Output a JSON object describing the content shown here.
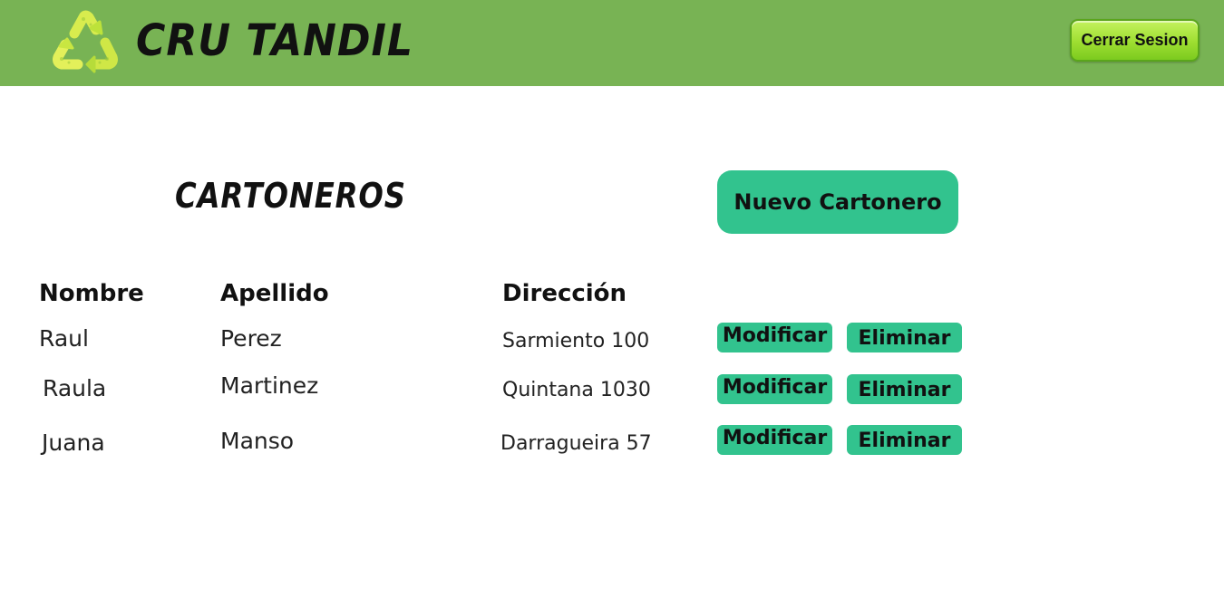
{
  "header": {
    "brand": "CRU TANDIL",
    "logo_icon": "recycle-icon",
    "logout_label": "Cerrar Sesion",
    "bar_color": "#78b354"
  },
  "main": {
    "title": "CARTONEROS",
    "new_button_label": "Nuevo Cartonero",
    "accent_color": "#32c38e"
  },
  "table": {
    "headers": {
      "nombre": "Nombre",
      "apellido": "Apellido",
      "direccion": "Dirección"
    },
    "rows": [
      {
        "nombre": "Raul",
        "apellido": "Perez",
        "direccion": "Sarmiento 100",
        "modify": "Modificar",
        "delete": "Eliminar"
      },
      {
        "nombre": "Raula",
        "apellido": "Martinez",
        "direccion": "Quintana 1030",
        "modify": "Modificar",
        "delete": "Eliminar"
      },
      {
        "nombre": "Juana",
        "apellido": "Manso",
        "direccion": "Darragueira 57",
        "modify": "Modificar",
        "delete": "Eliminar"
      }
    ]
  }
}
